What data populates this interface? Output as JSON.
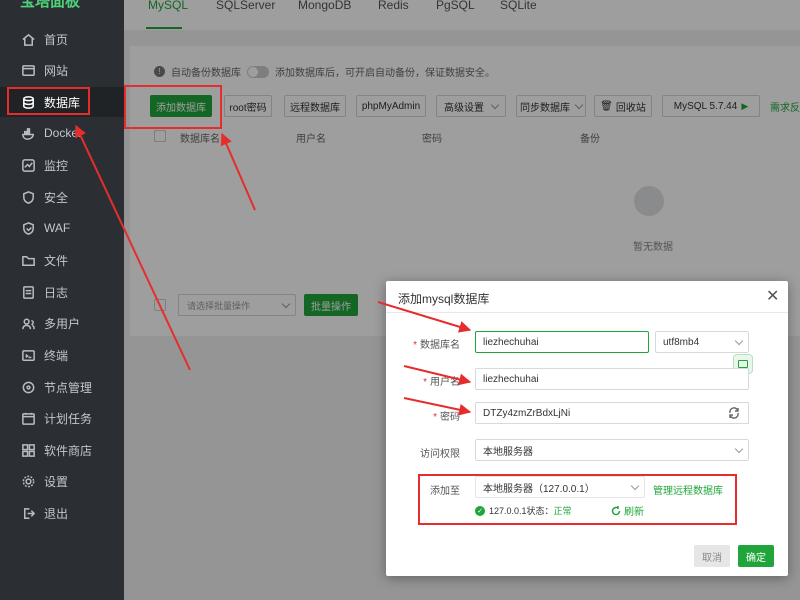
{
  "sidebar": {
    "logo": "宝塔面板",
    "items": [
      {
        "label": "首页",
        "icon": "home-icon"
      },
      {
        "label": "网站",
        "icon": "globe-icon"
      },
      {
        "label": "数据库",
        "icon": "database-icon"
      },
      {
        "label": "Docker",
        "icon": "docker-icon"
      },
      {
        "label": "监控",
        "icon": "monitor-icon"
      },
      {
        "label": "安全",
        "icon": "shield-icon"
      },
      {
        "label": "WAF",
        "icon": "waf-icon"
      },
      {
        "label": "文件",
        "icon": "folder-icon"
      },
      {
        "label": "日志",
        "icon": "log-icon"
      },
      {
        "label": "多用户",
        "icon": "users-icon"
      },
      {
        "label": "终端",
        "icon": "terminal-icon"
      },
      {
        "label": "节点管理",
        "icon": "node-icon"
      },
      {
        "label": "计划任务",
        "icon": "clock-icon"
      },
      {
        "label": "软件商店",
        "icon": "store-icon"
      },
      {
        "label": "设置",
        "icon": "gear-icon"
      },
      {
        "label": "退出",
        "icon": "logout-icon"
      }
    ]
  },
  "tabs": [
    "MySQL",
    "SQLServer",
    "MongoDB",
    "Redis",
    "PgSQL",
    "SQLite"
  ],
  "backup": {
    "label": "自动备份数据库",
    "hint": "添加数据库后，可开启自动备份，保证数据安全。"
  },
  "toolbar": {
    "add_db": "添加数据库",
    "root_pw": "root密码",
    "remote_db": "远程数据库",
    "phpmyadmin": "phpMyAdmin",
    "advanced": "高级设置",
    "sync_db": "同步数据库",
    "recycle": "回收站",
    "version": "MySQL 5.7.44",
    "more": "需求反"
  },
  "table": {
    "headers": [
      "数据库名",
      "用户名",
      "密码",
      "备份"
    ],
    "empty": "暂无数据"
  },
  "batch": {
    "placeholder": "请选择批量操作",
    "button": "批量操作"
  },
  "modal": {
    "title": "添加mysql数据库",
    "db_name_label": "数据库名",
    "db_name_value": "liezhechuhai",
    "charset": "utf8mb4",
    "user_label": "用户名",
    "user_value": "liezhechuhai",
    "pw_label": "密码",
    "pw_value": "DTZy4zmZrBdxLjNi",
    "access_label": "访问权限",
    "access_value": "本地服务器",
    "addto_label": "添加至",
    "addto_value": "本地服务器（127.0.0.1）",
    "remote_link": "管理远程数据库",
    "status_prefix": "127.0.0.1状态：",
    "status_value": "正常",
    "refresh": "刷新",
    "cancel": "取消",
    "confirm": "确定"
  },
  "colors": {
    "accent": "#20a53a",
    "highlight": "#e62d2d",
    "sidebar": "#2b2f33"
  }
}
